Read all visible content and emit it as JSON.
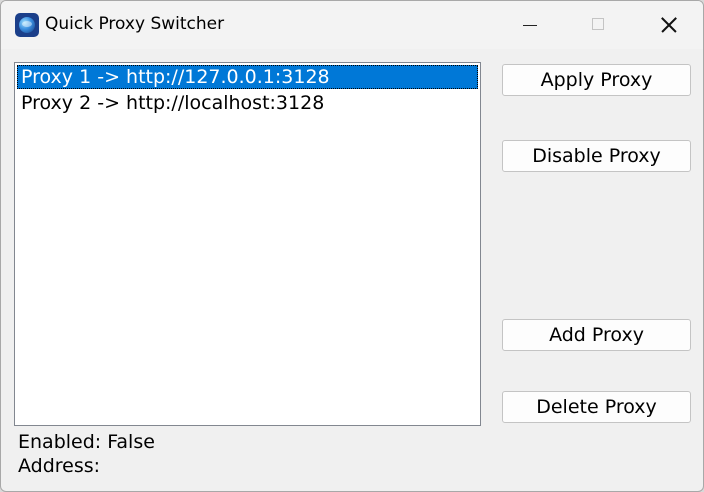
{
  "window": {
    "title": "Quick Proxy Switcher",
    "icon": "globe-app-icon",
    "controls": {
      "minimize": "minimize-icon",
      "maximize": "maximize-icon",
      "close": "close-icon"
    }
  },
  "proxy_list": {
    "items": [
      {
        "label": "Proxy 1 -> http://127.0.0.1:3128",
        "selected": true
      },
      {
        "label": "Proxy 2 -> http://localhost:3128",
        "selected": false
      }
    ],
    "selection_color": "#0078d7"
  },
  "buttons": {
    "apply": "Apply Proxy",
    "disable": "Disable Proxy",
    "add": "Add Proxy",
    "delete": "Delete Proxy"
  },
  "status": {
    "enabled": "Enabled: False",
    "address": "Address:"
  }
}
